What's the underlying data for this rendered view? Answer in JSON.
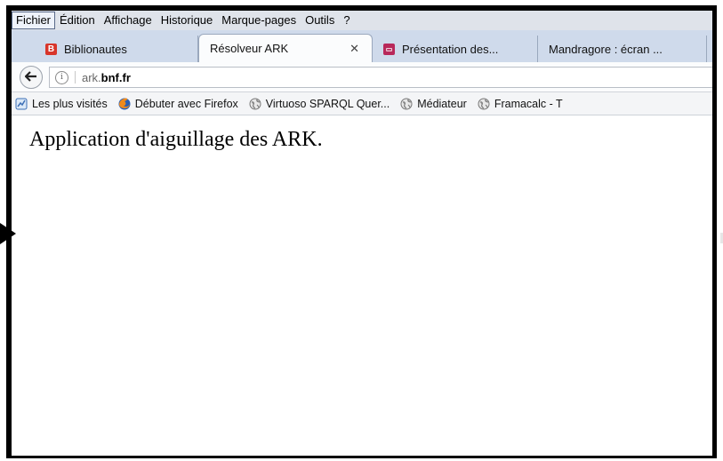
{
  "menu": [
    "Fichier",
    "Édition",
    "Affichage",
    "Historique",
    "Marque-pages",
    "Outils",
    "?"
  ],
  "tabs": [
    {
      "label": "Biblionautes",
      "icon": "B",
      "icon_name": "biblionautes-favicon",
      "color": "#d8352a"
    },
    {
      "label": "Résolveur ARK",
      "close": "✕",
      "selected": true
    },
    {
      "label": "Présentation des...",
      "icon": "▭",
      "icon_name": "presentation-favicon",
      "color": "#b8285a"
    },
    {
      "label": "Mandragore : écran ..."
    }
  ],
  "nav": {
    "back": "🡐",
    "info": "i",
    "url_host": "ark.",
    "url_domain": "bnf.fr"
  },
  "bookmarks": [
    {
      "label": "Les plus visités",
      "icon": "most-visited-icon"
    },
    {
      "label": "Débuter avec Firefox",
      "icon": "firefox-icon"
    },
    {
      "label": "Virtuoso SPARQL Quer...",
      "icon": "globe-icon"
    },
    {
      "label": "Médiateur",
      "icon": "globe-icon"
    },
    {
      "label": "Framacalc - T",
      "icon": "globe-icon"
    }
  ],
  "content": {
    "heading": "Application d'aiguillage des ARK."
  },
  "colors": {
    "menubar": "#dfe3ea",
    "tabstrip": "#cfdaeb",
    "frame": "#000000"
  }
}
